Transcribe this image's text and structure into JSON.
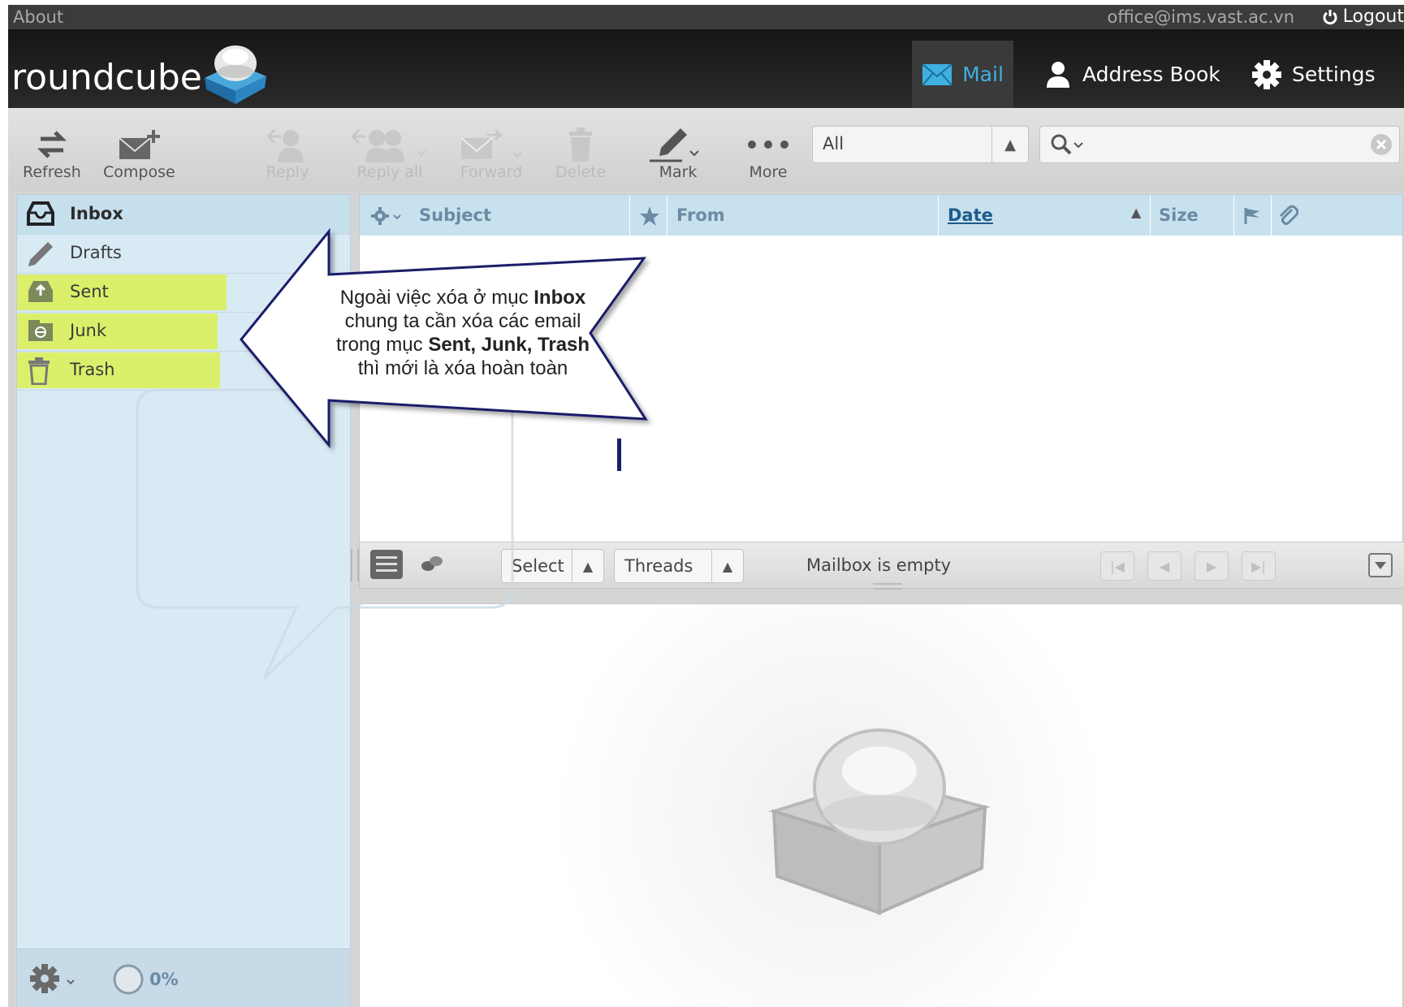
{
  "topbar": {
    "about": "About",
    "user_email": "office@ims.vast.ac.vn",
    "logout": "Logout"
  },
  "logo": {
    "text": "roundcube"
  },
  "nav": {
    "mail": "Mail",
    "address_book": "Address Book",
    "settings": "Settings"
  },
  "toolbar": {
    "refresh": "Refresh",
    "compose": "Compose",
    "reply": "Reply",
    "reply_all": "Reply all",
    "forward": "Forward",
    "delete": "Delete",
    "mark": "Mark",
    "more": "More",
    "filter_value": "All"
  },
  "folders": {
    "inbox": "Inbox",
    "drafts": "Drafts",
    "sent": "Sent",
    "junk": "Junk",
    "trash": "Trash"
  },
  "quota": {
    "text": "0%"
  },
  "list_columns": {
    "subject": "Subject",
    "from": "From",
    "date": "Date",
    "size": "Size"
  },
  "list_footer": {
    "select": "Select",
    "threads": "Threads",
    "status": "Mailbox is empty"
  },
  "callout": {
    "l1_a": "Ngoài việc xóa ở mục ",
    "l1_b": "Inbox",
    "l2": "chung ta cần xóa các email",
    "l3_a": "trong mục ",
    "l3_b": "Sent, Junk, Trash",
    "l4": "thì mới là xóa hoàn toàn"
  },
  "colors": {
    "accent": "#3fb0e0",
    "folder_bg": "#d8eaf4",
    "highlight": "#dbef6b",
    "header_bg": "#1e1e1e"
  }
}
